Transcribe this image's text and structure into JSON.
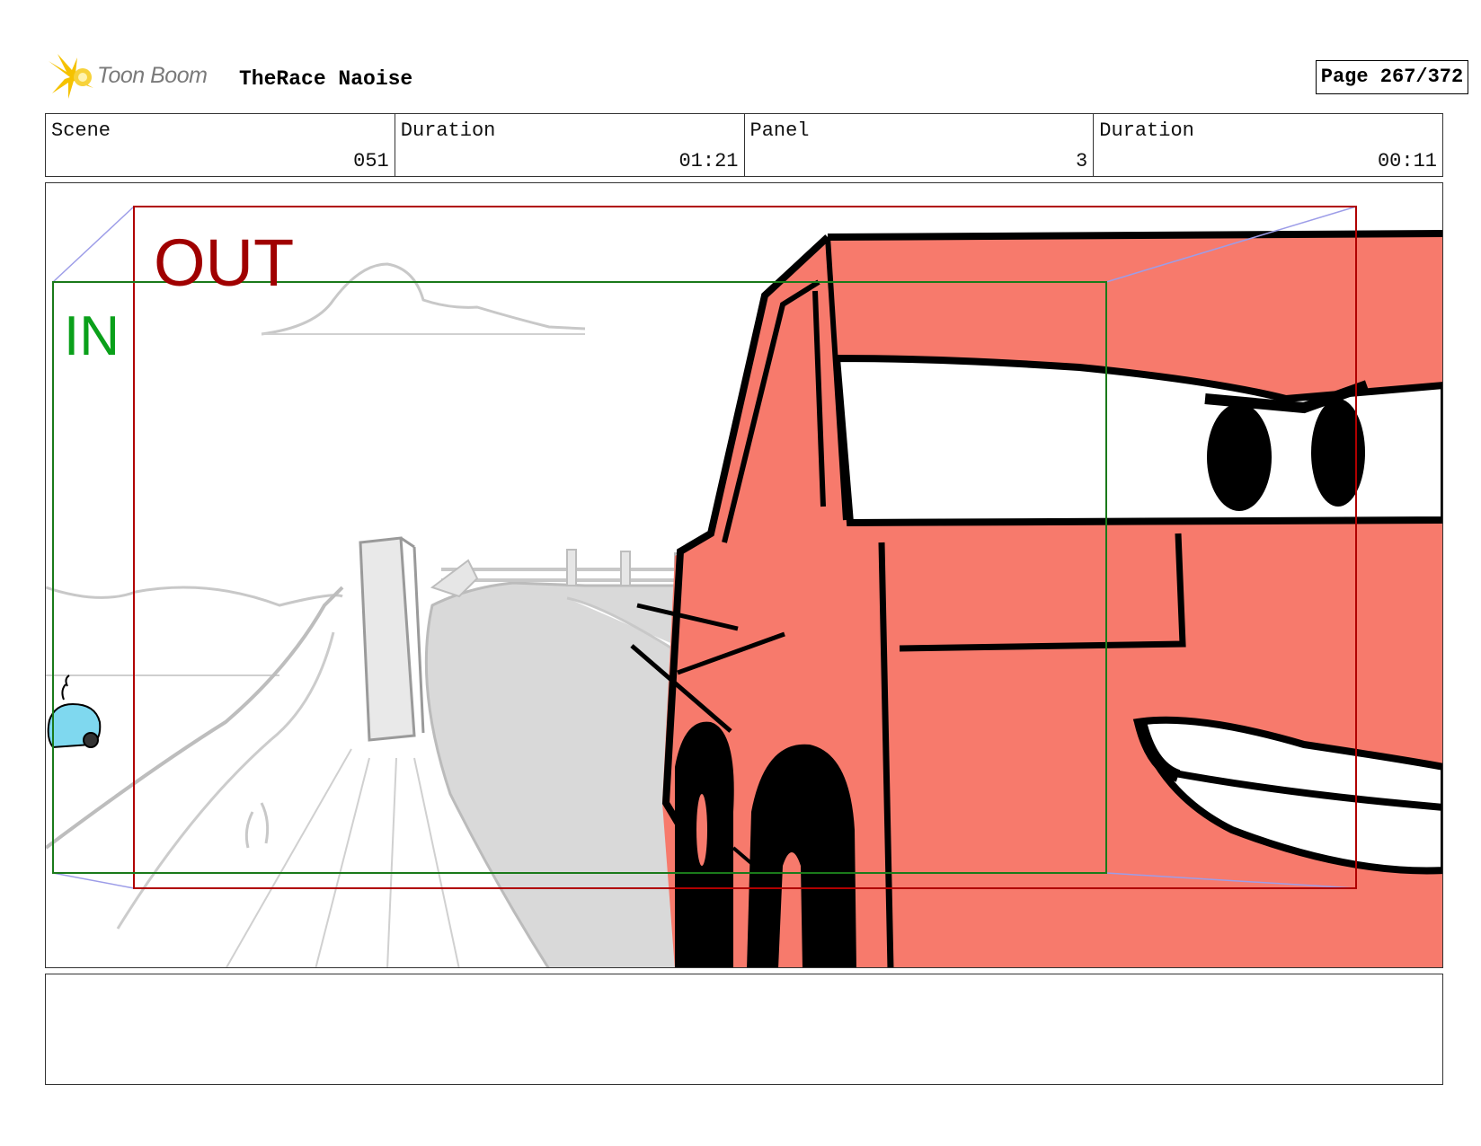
{
  "header": {
    "logo_text": "Toon Boom",
    "project_title": "TheRace Naoise",
    "page_label": "Page 267/372"
  },
  "info": [
    {
      "label": "Scene",
      "value": "051"
    },
    {
      "label": "Duration",
      "value": "01:21"
    },
    {
      "label": "Panel",
      "value": "3"
    },
    {
      "label": "Duration",
      "value": "00:11"
    }
  ],
  "panel": {
    "out_label": "OUT",
    "in_label": "IN"
  },
  "notes": {
    "text": ""
  },
  "colors": {
    "truck_body": "#f77a6c",
    "out_frame": "#b00000",
    "in_frame": "#1a7a1a",
    "road": "#d7d7d7",
    "logo_star": "#f5c200"
  }
}
